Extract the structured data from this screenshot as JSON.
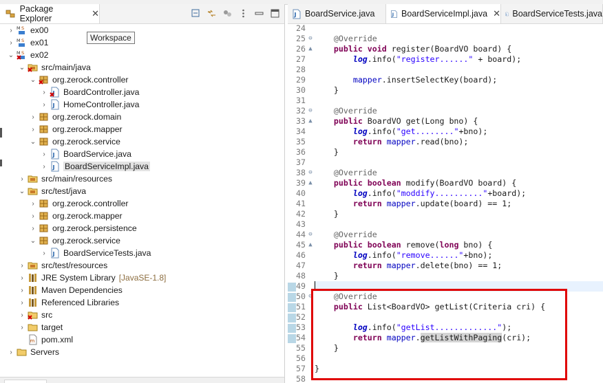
{
  "package_explorer": {
    "tab_title": "Package Explorer",
    "close_glyph": "✕",
    "tooltip": "Workspace",
    "tree": [
      {
        "label": "ex00",
        "icon": "maven-project-icon",
        "twisty": ">",
        "indent": 0
      },
      {
        "label": "ex01",
        "icon": "maven-project-icon",
        "twisty": ">",
        "indent": 0
      },
      {
        "label": "ex02",
        "icon": "maven-project-error-icon",
        "twisty": "v",
        "indent": 0
      },
      {
        "label": "src/main/java",
        "icon": "source-folder-error-icon",
        "twisty": "v",
        "indent": 1
      },
      {
        "label": "org.zerock.controller",
        "icon": "package-error-icon",
        "twisty": "v",
        "indent": 2
      },
      {
        "label": "BoardController.java",
        "icon": "java-file-error-icon",
        "twisty": ">",
        "indent": 3
      },
      {
        "label": "HomeController.java",
        "icon": "java-file-icon",
        "twisty": ">",
        "indent": 3
      },
      {
        "label": "org.zerock.domain",
        "icon": "package-icon",
        "twisty": ">",
        "indent": 2
      },
      {
        "label": "org.zerock.mapper",
        "icon": "package-icon",
        "twisty": ">",
        "indent": 2
      },
      {
        "label": "org.zerock.service",
        "icon": "package-icon",
        "twisty": "v",
        "indent": 2
      },
      {
        "label": "BoardService.java",
        "icon": "java-file-icon",
        "twisty": ">",
        "indent": 3
      },
      {
        "label": "BoardServiceImpl.java",
        "icon": "java-file-icon",
        "twisty": ">",
        "indent": 3,
        "selected": true
      },
      {
        "label": "src/main/resources",
        "icon": "source-folder-icon",
        "twisty": ">",
        "indent": 1
      },
      {
        "label": "src/test/java",
        "icon": "source-folder-icon",
        "twisty": "v",
        "indent": 1
      },
      {
        "label": "org.zerock.controller",
        "icon": "package-icon",
        "twisty": ">",
        "indent": 2
      },
      {
        "label": "org.zerock.mapper",
        "icon": "package-icon",
        "twisty": ">",
        "indent": 2
      },
      {
        "label": "org.zerock.persistence",
        "icon": "package-icon",
        "twisty": ">",
        "indent": 2
      },
      {
        "label": "org.zerock.service",
        "icon": "package-icon",
        "twisty": "v",
        "indent": 2
      },
      {
        "label": "BoardServiceTests.java",
        "icon": "java-file-icon",
        "twisty": ">",
        "indent": 3
      },
      {
        "label": "src/test/resources",
        "icon": "source-folder-icon",
        "twisty": ">",
        "indent": 1
      },
      {
        "label": "JRE System Library",
        "sublabel": "[JavaSE-1.8]",
        "icon": "library-icon",
        "twisty": ">",
        "indent": 1
      },
      {
        "label": "Maven Dependencies",
        "icon": "library-icon",
        "twisty": ">",
        "indent": 1
      },
      {
        "label": "Referenced Libraries",
        "icon": "library-icon",
        "twisty": ">",
        "indent": 1
      },
      {
        "label": "src",
        "icon": "folder-error-icon",
        "twisty": ">",
        "indent": 1
      },
      {
        "label": "target",
        "icon": "folder-icon",
        "twisty": ">",
        "indent": 1
      },
      {
        "label": "pom.xml",
        "icon": "xml-file-icon",
        "twisty": "",
        "indent": 1
      },
      {
        "label": "Servers",
        "icon": "folder-icon",
        "twisty": ">",
        "indent": 0
      }
    ]
  },
  "editor": {
    "tabs": [
      {
        "label": "BoardService.java",
        "active": false,
        "closable": false
      },
      {
        "label": "BoardServiceImpl.java",
        "active": true,
        "closable": true
      },
      {
        "label": "BoardServiceTests.java",
        "active": false,
        "closable": false
      }
    ],
    "close_glyph": "✕",
    "lines": [
      {
        "n": "24",
        "fold": "",
        "tokens": []
      },
      {
        "n": "25",
        "fold": "⊖",
        "tokens": [
          {
            "c": "ann",
            "t": "    @Override"
          }
        ]
      },
      {
        "n": "26",
        "fold": "▲",
        "tokens": [
          {
            "c": "",
            "t": "    "
          },
          {
            "c": "kw",
            "t": "public"
          },
          {
            "c": "",
            "t": " "
          },
          {
            "c": "kw",
            "t": "void"
          },
          {
            "c": "",
            "t": " register(BoardVO board) {"
          }
        ]
      },
      {
        "n": "27",
        "fold": "",
        "tokens": [
          {
            "c": "",
            "t": "        "
          },
          {
            "c": "stat",
            "t": "log"
          },
          {
            "c": "",
            "t": ".info("
          },
          {
            "c": "str",
            "t": "\"register......\""
          },
          {
            "c": "",
            "t": " + board);"
          }
        ]
      },
      {
        "n": "28",
        "fold": "",
        "tokens": []
      },
      {
        "n": "29",
        "fold": "",
        "tokens": [
          {
            "c": "",
            "t": "        "
          },
          {
            "c": "fld",
            "t": "mapper"
          },
          {
            "c": "",
            "t": ".insertSelectKey(board);"
          }
        ]
      },
      {
        "n": "30",
        "fold": "",
        "tokens": [
          {
            "c": "",
            "t": "    }"
          }
        ]
      },
      {
        "n": "31",
        "fold": "",
        "tokens": []
      },
      {
        "n": "32",
        "fold": "⊖",
        "tokens": [
          {
            "c": "ann",
            "t": "    @Override"
          }
        ]
      },
      {
        "n": "33",
        "fold": "▲",
        "tokens": [
          {
            "c": "",
            "t": "    "
          },
          {
            "c": "kw",
            "t": "public"
          },
          {
            "c": "",
            "t": " BoardVO get(Long bno) {"
          }
        ]
      },
      {
        "n": "34",
        "fold": "",
        "tokens": [
          {
            "c": "",
            "t": "        "
          },
          {
            "c": "stat",
            "t": "log"
          },
          {
            "c": "",
            "t": ".info("
          },
          {
            "c": "str",
            "t": "\"get........\""
          },
          {
            "c": "",
            "t": "+bno);"
          }
        ]
      },
      {
        "n": "35",
        "fold": "",
        "tokens": [
          {
            "c": "",
            "t": "        "
          },
          {
            "c": "kw",
            "t": "return"
          },
          {
            "c": "",
            "t": " "
          },
          {
            "c": "fld",
            "t": "mapper"
          },
          {
            "c": "",
            "t": ".read(bno);"
          }
        ]
      },
      {
        "n": "36",
        "fold": "",
        "tokens": [
          {
            "c": "",
            "t": "    }"
          }
        ]
      },
      {
        "n": "37",
        "fold": "",
        "tokens": []
      },
      {
        "n": "38",
        "fold": "⊖",
        "tokens": [
          {
            "c": "ann",
            "t": "    @Override"
          }
        ]
      },
      {
        "n": "39",
        "fold": "▲",
        "tokens": [
          {
            "c": "",
            "t": "    "
          },
          {
            "c": "kw",
            "t": "public"
          },
          {
            "c": "",
            "t": " "
          },
          {
            "c": "kw",
            "t": "boolean"
          },
          {
            "c": "",
            "t": " modify(BoardVO board) {"
          }
        ]
      },
      {
        "n": "40",
        "fold": "",
        "tokens": [
          {
            "c": "",
            "t": "        "
          },
          {
            "c": "stat",
            "t": "log"
          },
          {
            "c": "",
            "t": ".info("
          },
          {
            "c": "str",
            "t": "\"moddify..........\""
          },
          {
            "c": "",
            "t": "+board);"
          }
        ]
      },
      {
        "n": "41",
        "fold": "",
        "tokens": [
          {
            "c": "",
            "t": "        "
          },
          {
            "c": "kw",
            "t": "return"
          },
          {
            "c": "",
            "t": " "
          },
          {
            "c": "fld",
            "t": "mapper"
          },
          {
            "c": "",
            "t": ".update(board) == 1;"
          }
        ]
      },
      {
        "n": "42",
        "fold": "",
        "tokens": [
          {
            "c": "",
            "t": "    }"
          }
        ]
      },
      {
        "n": "43",
        "fold": "",
        "tokens": []
      },
      {
        "n": "44",
        "fold": "⊖",
        "tokens": [
          {
            "c": "ann",
            "t": "    @Override"
          }
        ]
      },
      {
        "n": "45",
        "fold": "▲",
        "tokens": [
          {
            "c": "",
            "t": "    "
          },
          {
            "c": "kw",
            "t": "public"
          },
          {
            "c": "",
            "t": " "
          },
          {
            "c": "kw",
            "t": "boolean"
          },
          {
            "c": "",
            "t": " remove("
          },
          {
            "c": "kw",
            "t": "long"
          },
          {
            "c": "",
            "t": " bno) {"
          }
        ]
      },
      {
        "n": "46",
        "fold": "",
        "tokens": [
          {
            "c": "",
            "t": "        "
          },
          {
            "c": "stat",
            "t": "log"
          },
          {
            "c": "",
            "t": ".info("
          },
          {
            "c": "str",
            "t": "\"remove......\""
          },
          {
            "c": "",
            "t": "+bno);"
          }
        ]
      },
      {
        "n": "47",
        "fold": "",
        "tokens": [
          {
            "c": "",
            "t": "        "
          },
          {
            "c": "kw",
            "t": "return"
          },
          {
            "c": "",
            "t": " "
          },
          {
            "c": "fld",
            "t": "mapper"
          },
          {
            "c": "",
            "t": ".delete(bno) == 1;"
          }
        ]
      },
      {
        "n": "48",
        "fold": "",
        "tokens": [
          {
            "c": "",
            "t": "    }"
          }
        ]
      },
      {
        "n": "49",
        "fold": "",
        "tokens": [],
        "current": true
      },
      {
        "n": "50",
        "fold": "⊖",
        "tokens": [
          {
            "c": "ann",
            "t": "    @Override"
          }
        ]
      },
      {
        "n": "51",
        "fold": "",
        "tokens": [
          {
            "c": "",
            "t": "    "
          },
          {
            "c": "kw",
            "t": "public"
          },
          {
            "c": "",
            "t": " List<BoardVO> getList(Criteria cri) {"
          }
        ]
      },
      {
        "n": "52",
        "fold": "",
        "tokens": []
      },
      {
        "n": "53",
        "fold": "",
        "tokens": [
          {
            "c": "",
            "t": "        "
          },
          {
            "c": "stat",
            "t": "log"
          },
          {
            "c": "",
            "t": ".info("
          },
          {
            "c": "str",
            "t": "\"getList.............\""
          },
          {
            "c": "",
            "t": ");"
          }
        ]
      },
      {
        "n": "54",
        "fold": "",
        "tokens": [
          {
            "c": "",
            "t": "        "
          },
          {
            "c": "kw",
            "t": "return"
          },
          {
            "c": "",
            "t": " "
          },
          {
            "c": "fld",
            "t": "mapper"
          },
          {
            "c": "",
            "t": "."
          },
          {
            "c": "hl",
            "t": "getListWithPaging"
          },
          {
            "c": "",
            "t": "(cri);"
          }
        ]
      },
      {
        "n": "55",
        "fold": "",
        "tokens": [
          {
            "c": "",
            "t": "    }"
          }
        ]
      },
      {
        "n": "56",
        "fold": "",
        "tokens": []
      },
      {
        "n": "57",
        "fold": "",
        "tokens": [
          {
            "c": "",
            "t": "}"
          }
        ]
      },
      {
        "n": "58",
        "fold": "",
        "tokens": []
      }
    ]
  },
  "colors": {
    "keyword": "#7f0055",
    "string": "#2a00ff",
    "field": "#0000c0",
    "annotation": "#646464",
    "highlight_box": "#e00000"
  }
}
